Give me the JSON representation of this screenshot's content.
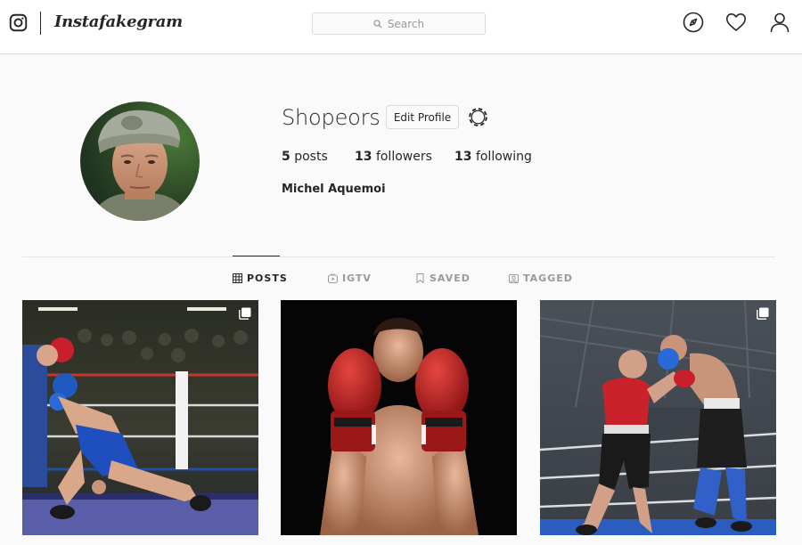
{
  "header": {
    "app_name": "Instafakegram",
    "search_placeholder": "Search",
    "icons": [
      "instagram-camera-icon",
      "compass-icon",
      "heart-icon",
      "user-icon"
    ]
  },
  "profile": {
    "username": "Shopeors",
    "edit_label": "Edit Profile",
    "posts_count": "5",
    "posts_label": "posts",
    "followers_count": "13",
    "followers_label": "followers",
    "following_count": "13",
    "following_label": "following",
    "full_name": "Michel Aquemoi"
  },
  "tabs": [
    {
      "label": "POSTS",
      "icon": "grid-icon",
      "active": true
    },
    {
      "label": "IGTV",
      "icon": "igtv-icon",
      "active": false
    },
    {
      "label": "SAVED",
      "icon": "bookmark-icon",
      "active": false
    },
    {
      "label": "TAGGED",
      "icon": "tagged-icon",
      "active": false
    }
  ],
  "posts": [
    {
      "subject": "boxing match blue and red",
      "multi": true
    },
    {
      "subject": "boxer portrait red gloves",
      "multi": false
    },
    {
      "subject": "boxing match red and black",
      "multi": true
    }
  ],
  "colors": {
    "border": "#dbdbdb",
    "text": "#262626",
    "muted": "#999999",
    "background": "#fafafa"
  }
}
